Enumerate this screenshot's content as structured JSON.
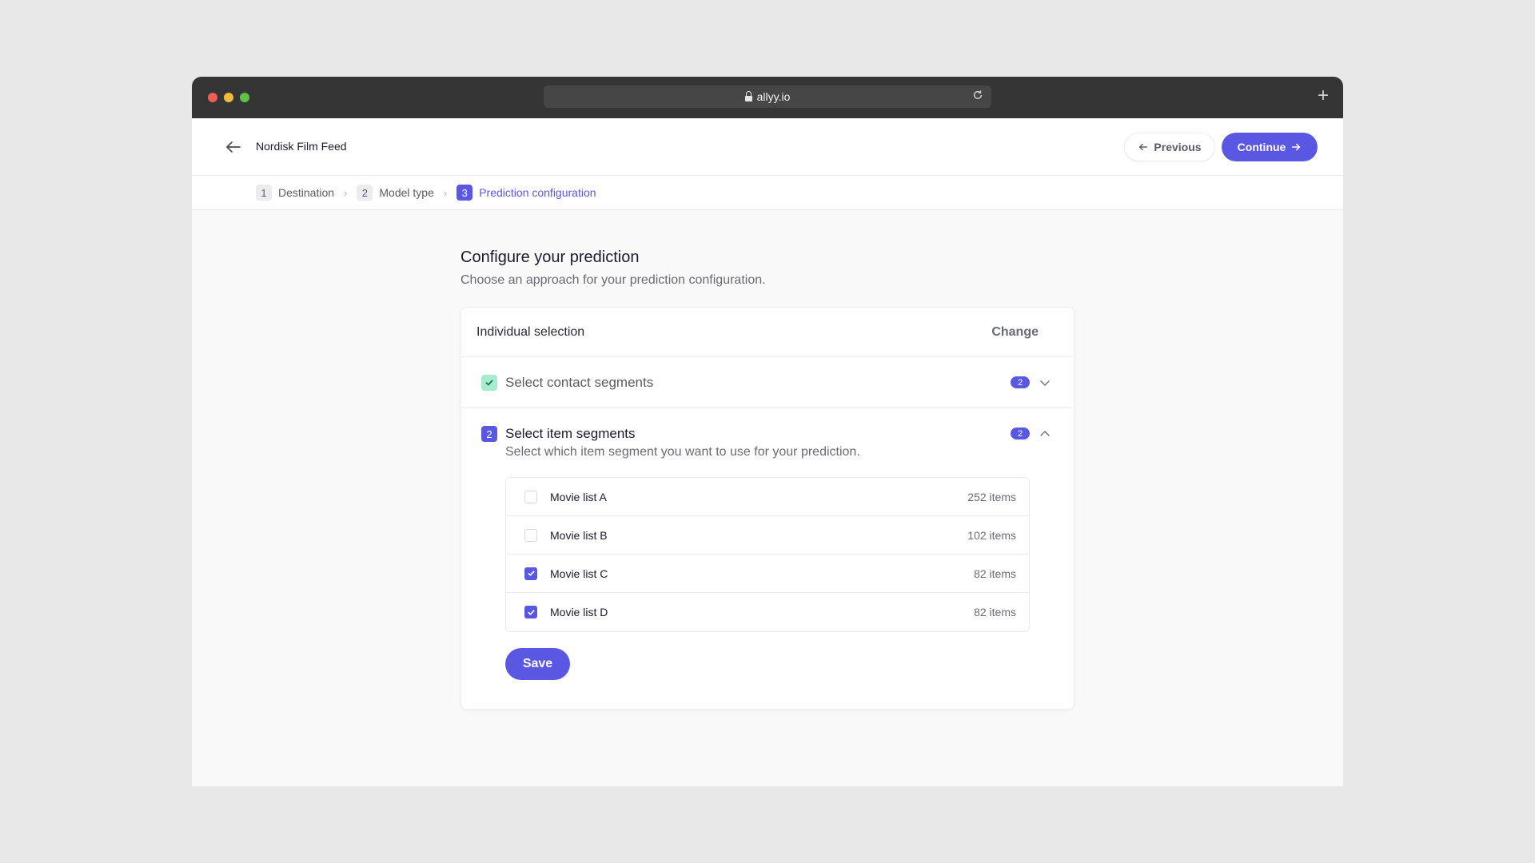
{
  "browser": {
    "url": "allyy.io",
    "icons": {
      "lock": "lock-icon",
      "reload": "reload-icon",
      "new_tab": "plus-icon"
    }
  },
  "header": {
    "title": "Nordisk Film Feed",
    "previous_label": "Previous",
    "continue_label": "Continue"
  },
  "breadcrumb": [
    {
      "num": "1",
      "label": "Destination",
      "active": false
    },
    {
      "num": "2",
      "label": "Model type",
      "active": false
    },
    {
      "num": "3",
      "label": "Prediction configuration",
      "active": true
    }
  ],
  "main": {
    "title": "Configure your prediction",
    "subtitle": "Choose an approach for your prediction configuration."
  },
  "card": {
    "title": "Individual selection",
    "change_label": "Change",
    "sections": [
      {
        "title": "Select contact segments",
        "status": "done",
        "count": "2",
        "expanded": false
      },
      {
        "num": "2",
        "title": "Select item segments",
        "description": "Select which item segment you want to use for your prediction.",
        "count": "2",
        "expanded": true
      }
    ],
    "items": [
      {
        "label": "Movie list A",
        "count": "252 items",
        "checked": false
      },
      {
        "label": "Movie list B",
        "count": "102 items",
        "checked": false
      },
      {
        "label": "Movie list C",
        "count": "82 items",
        "checked": true
      },
      {
        "label": "Movie list D",
        "count": "82 items",
        "checked": true
      }
    ],
    "save_label": "Save"
  },
  "colors": {
    "accent": "#5a57e3",
    "success_bg": "#a8ecd0",
    "success_fg": "#137a4c",
    "chrome": "#353535"
  }
}
